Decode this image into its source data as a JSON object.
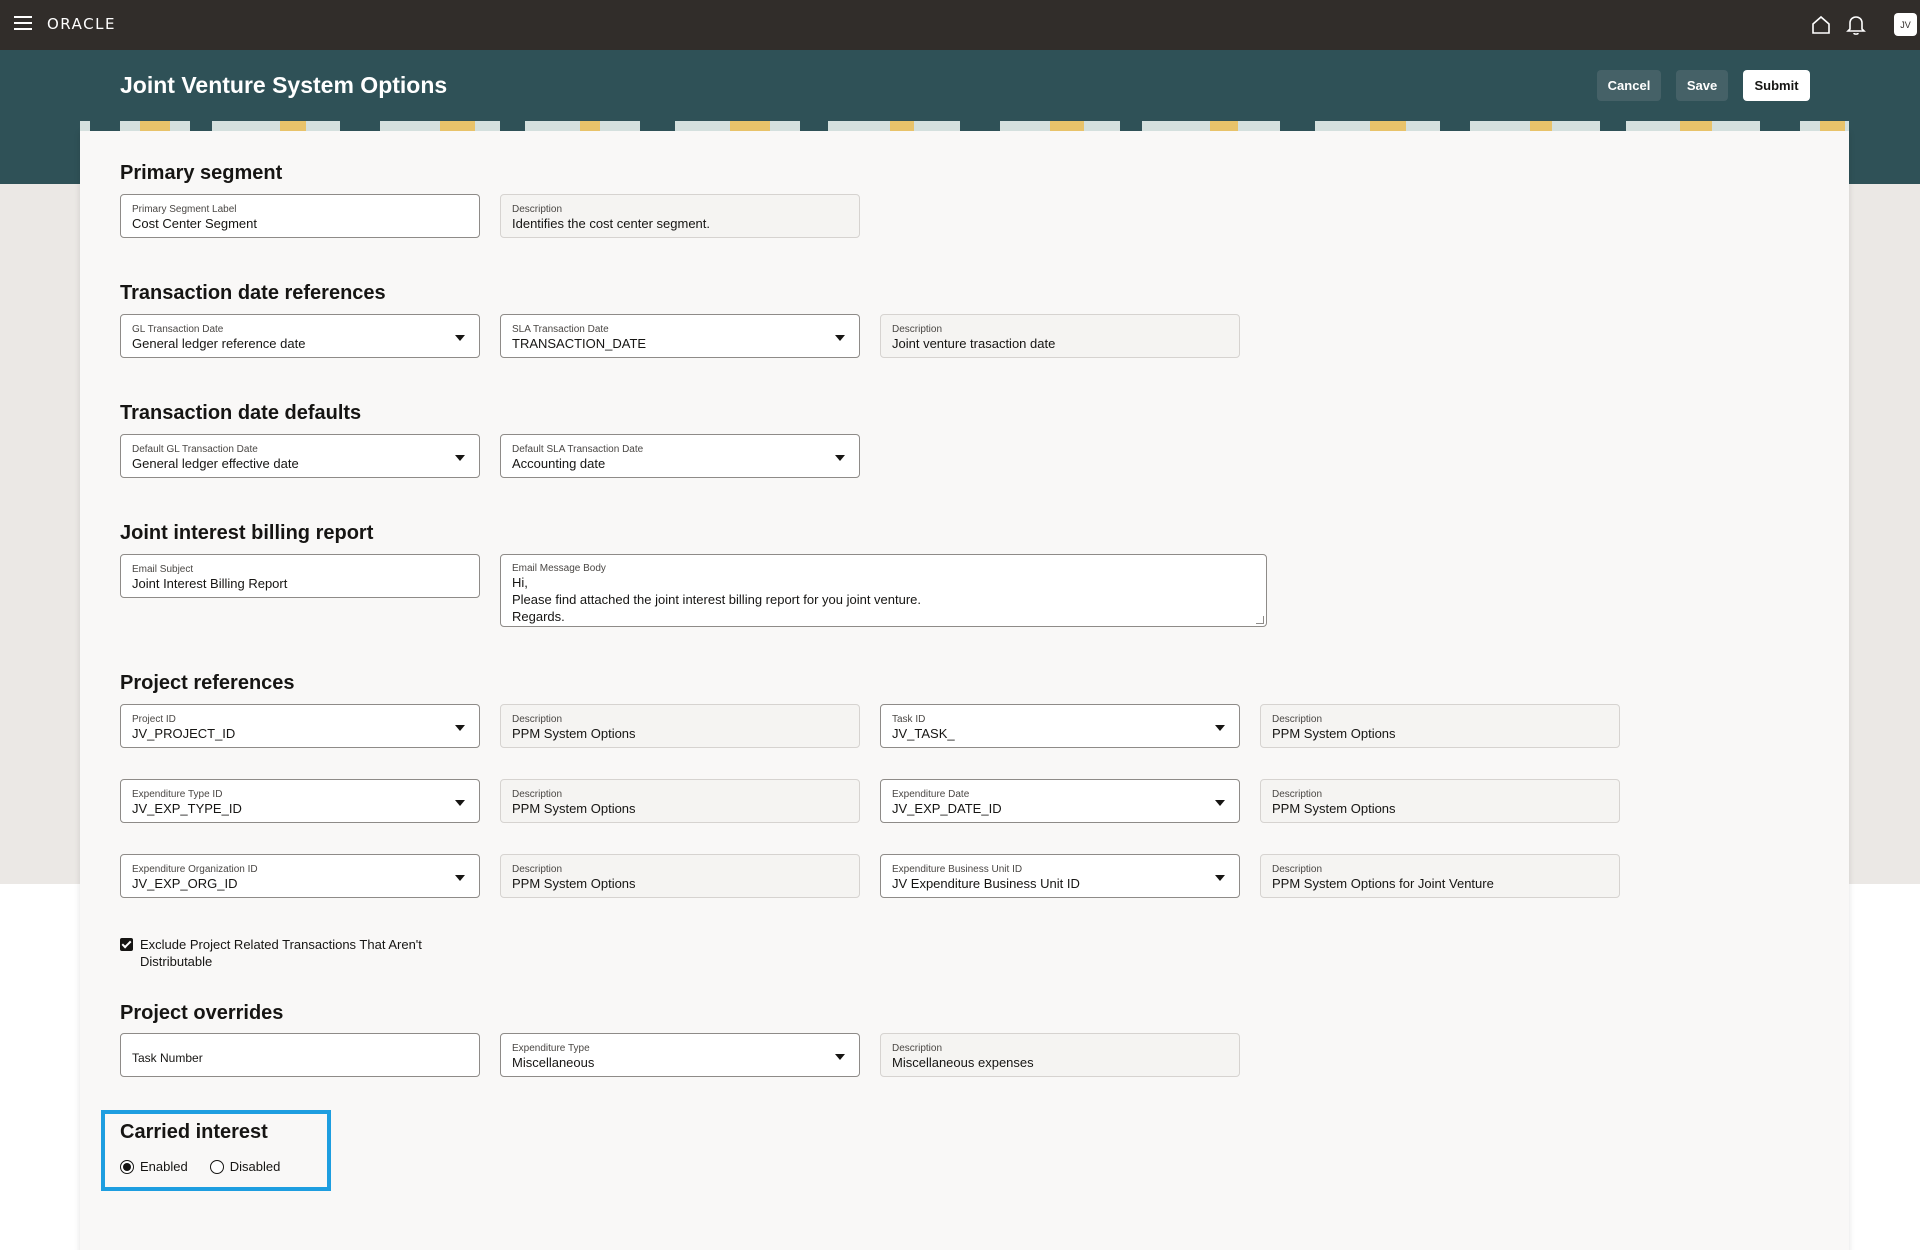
{
  "app": {
    "logo": "ORACLE",
    "avatar_initials": "JV"
  },
  "header": {
    "title": "Joint Venture System Options",
    "buttons": {
      "cancel": "Cancel",
      "save": "Save",
      "submit": "Submit"
    }
  },
  "sections": {
    "primary_segment": {
      "title": "Primary segment",
      "label_field": {
        "label": "Primary Segment Label",
        "value": "Cost Center Segment"
      },
      "description": {
        "label": "Description",
        "value": "Identifies the cost center segment."
      }
    },
    "transaction_date_references": {
      "title": "Transaction date references",
      "gl": {
        "label": "GL Transaction Date",
        "value": "General ledger reference date"
      },
      "sla": {
        "label": "SLA Transaction Date",
        "value": "TRANSACTION_DATE"
      },
      "description": {
        "label": "Description",
        "value": "Joint venture trasaction date"
      }
    },
    "transaction_date_defaults": {
      "title": "Transaction date defaults",
      "gl": {
        "label": "Default GL Transaction Date",
        "value": "General ledger effective date"
      },
      "sla": {
        "label": "Default SLA Transaction Date",
        "value": "Accounting date"
      }
    },
    "jib_report": {
      "title": "Joint interest billing report",
      "email_subject": {
        "label": "Email Subject",
        "value": "Joint Interest Billing Report"
      },
      "email_body": {
        "label": "Email Message Body",
        "lines": [
          "Hi,",
          "Please find attached the joint interest billing report for you joint venture.",
          "Regards."
        ]
      }
    },
    "project_references": {
      "title": "Project references",
      "project_id": {
        "label": "Project ID",
        "value": "JV_PROJECT_ID"
      },
      "project_desc": {
        "label": "Description",
        "value": "PPM System Options"
      },
      "task_id": {
        "label": "Task ID",
        "value": "JV_TASK_"
      },
      "task_desc": {
        "label": "Description",
        "value": "PPM System Options"
      },
      "exp_type_id": {
        "label": "Expenditure Type ID",
        "value": "JV_EXP_TYPE_ID"
      },
      "exp_type_desc": {
        "label": "Description",
        "value": "PPM System Options"
      },
      "exp_date": {
        "label": "Expenditure Date",
        "value": "JV_EXP_DATE_ID"
      },
      "exp_date_desc": {
        "label": "Description",
        "value": "PPM System Options"
      },
      "exp_org_id": {
        "label": "Expenditure Organization ID",
        "value": "JV_EXP_ORG_ID"
      },
      "exp_org_desc": {
        "label": "Description",
        "value": "PPM System Options"
      },
      "exp_bu_id": {
        "label": "Expenditure Business Unit ID",
        "value": "JV Expenditure Business Unit ID"
      },
      "exp_bu_desc": {
        "label": "Description",
        "value": "PPM System Options for Joint Venture"
      },
      "exclude_checkbox": {
        "label": "Exclude Project Related Transactions That Aren't Distributable",
        "checked": true
      }
    },
    "project_overrides": {
      "title": "Project overrides",
      "task_number": {
        "placeholder": "Task Number"
      },
      "exp_type": {
        "label": "Expenditure Type",
        "value": "Miscellaneous"
      },
      "description": {
        "label": "Description",
        "value": "Miscellaneous expenses"
      }
    },
    "carried_interest": {
      "title": "Carried interest",
      "options": [
        {
          "label": "Enabled",
          "selected": true
        },
        {
          "label": "Disabled",
          "selected": false
        }
      ],
      "highlight_color": "#1e9ee0"
    }
  }
}
